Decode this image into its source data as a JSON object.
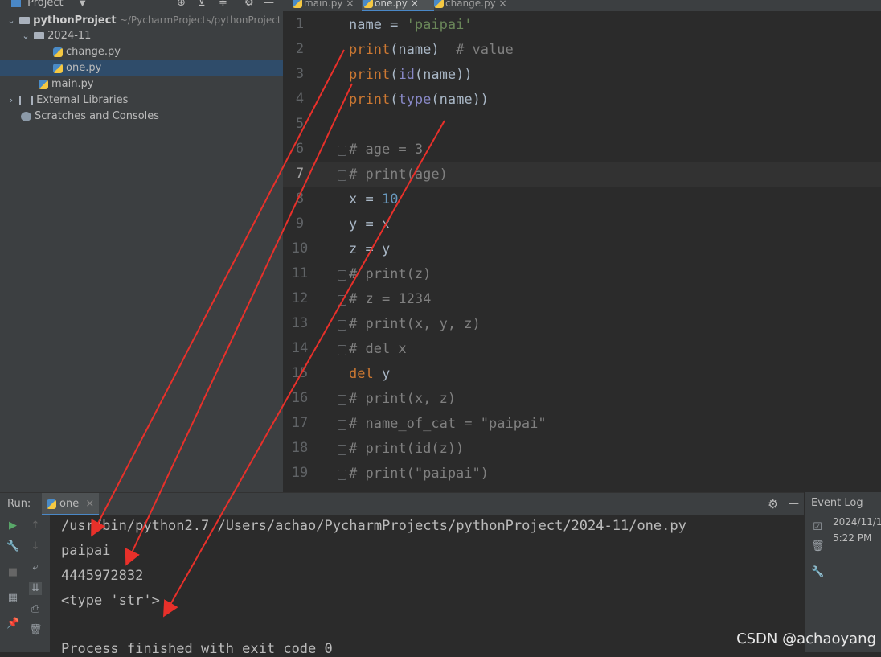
{
  "project_panel": {
    "header_label": "Project",
    "root_name": "pythonProject",
    "root_path": "~/PycharmProjects/pythonProject",
    "folder_name": "2024-11",
    "files_in_folder": [
      "change.py",
      "one.py"
    ],
    "root_file": "main.py",
    "external_libraries": "External Libraries",
    "scratches": "Scratches and Consoles"
  },
  "editor": {
    "tabs": [
      "main.py",
      "one.py",
      "change.py"
    ],
    "active_tab": "one.py",
    "line_numbers": [
      "1",
      "2",
      "3",
      "4",
      "5",
      "6",
      "7",
      "8",
      "9",
      "10",
      "11",
      "12",
      "13",
      "14",
      "15",
      "16",
      "17",
      "18",
      "19"
    ],
    "lines": [
      "name = 'paipai'",
      "print(name)  # value",
      "print(id(name))",
      "print(type(name))",
      "",
      "# age = 3",
      "# print(age)",
      "x = 10",
      "y = x",
      "z = y",
      "# print(z)",
      "# z = 1234",
      "# print(x, y, z)",
      "# del x",
      "del y",
      "# print(x, z)",
      "# name_of_cat = \"paipai\"",
      "# print(id(z))",
      "# print(\"paipai\")"
    ],
    "current_line": "7"
  },
  "run": {
    "label": "Run:",
    "config_name": "one",
    "console_lines": [
      "/usr/bin/python2.7 /Users/achao/PycharmProjects/pythonProject/2024-11/one.py",
      "paipai",
      "4445972832",
      "<type 'str'>",
      "",
      "Process finished with exit code 0"
    ]
  },
  "event_log": {
    "title": "Event Log",
    "date": "2024/11/1",
    "time": "5:22 PM"
  },
  "watermark": "CSDN @achaoyang",
  "colors": {
    "keyword": "#cc7832",
    "string": "#6a8759",
    "number": "#6897bb",
    "comment": "#808080",
    "arrow": "#e8302a"
  }
}
